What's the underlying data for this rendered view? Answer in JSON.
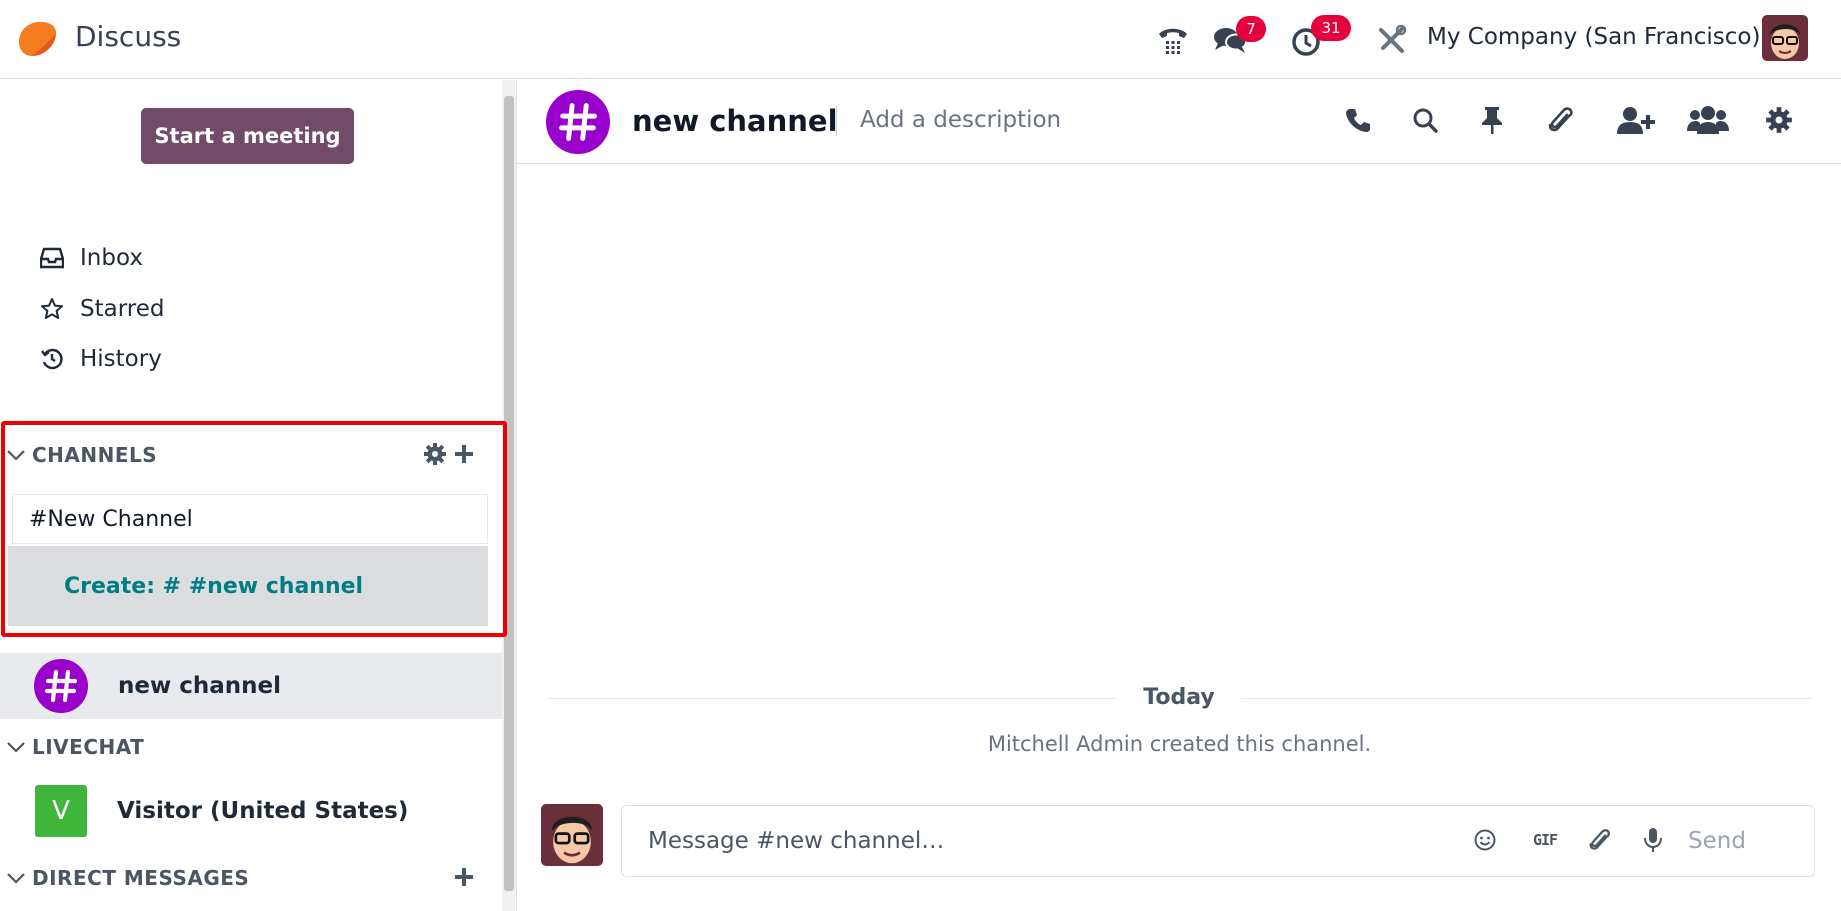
{
  "app": {
    "title": "Discuss",
    "company": "My Company (San Francisco)",
    "messages_badge": "7",
    "activities_badge": "31",
    "accent_color": "#714b67"
  },
  "sidebar": {
    "meeting_button": "Start a meeting",
    "nav": [
      {
        "label": "Inbox",
        "icon": "inbox-icon"
      },
      {
        "label": "Starred",
        "icon": "star-icon"
      },
      {
        "label": "History",
        "icon": "history-icon"
      }
    ],
    "channels": {
      "title": "CHANNELS",
      "search_value": "#New Channel",
      "create_label": "Create: # #new channel",
      "items": [
        {
          "name": "new channel"
        }
      ]
    },
    "livechat": {
      "title": "LIVECHAT",
      "items": [
        {
          "name": "Visitor (United States)",
          "initial": "V"
        }
      ]
    },
    "direct_messages": {
      "title": "DIRECT MESSAGES"
    }
  },
  "thread": {
    "name": "new channel",
    "description_placeholder": "Add a description",
    "date_separator": "Today",
    "system_message": "Mitchell Admin created this channel.",
    "composer_placeholder": "Message #new channel…",
    "gif_label": "GIF",
    "send_label": "Send"
  }
}
